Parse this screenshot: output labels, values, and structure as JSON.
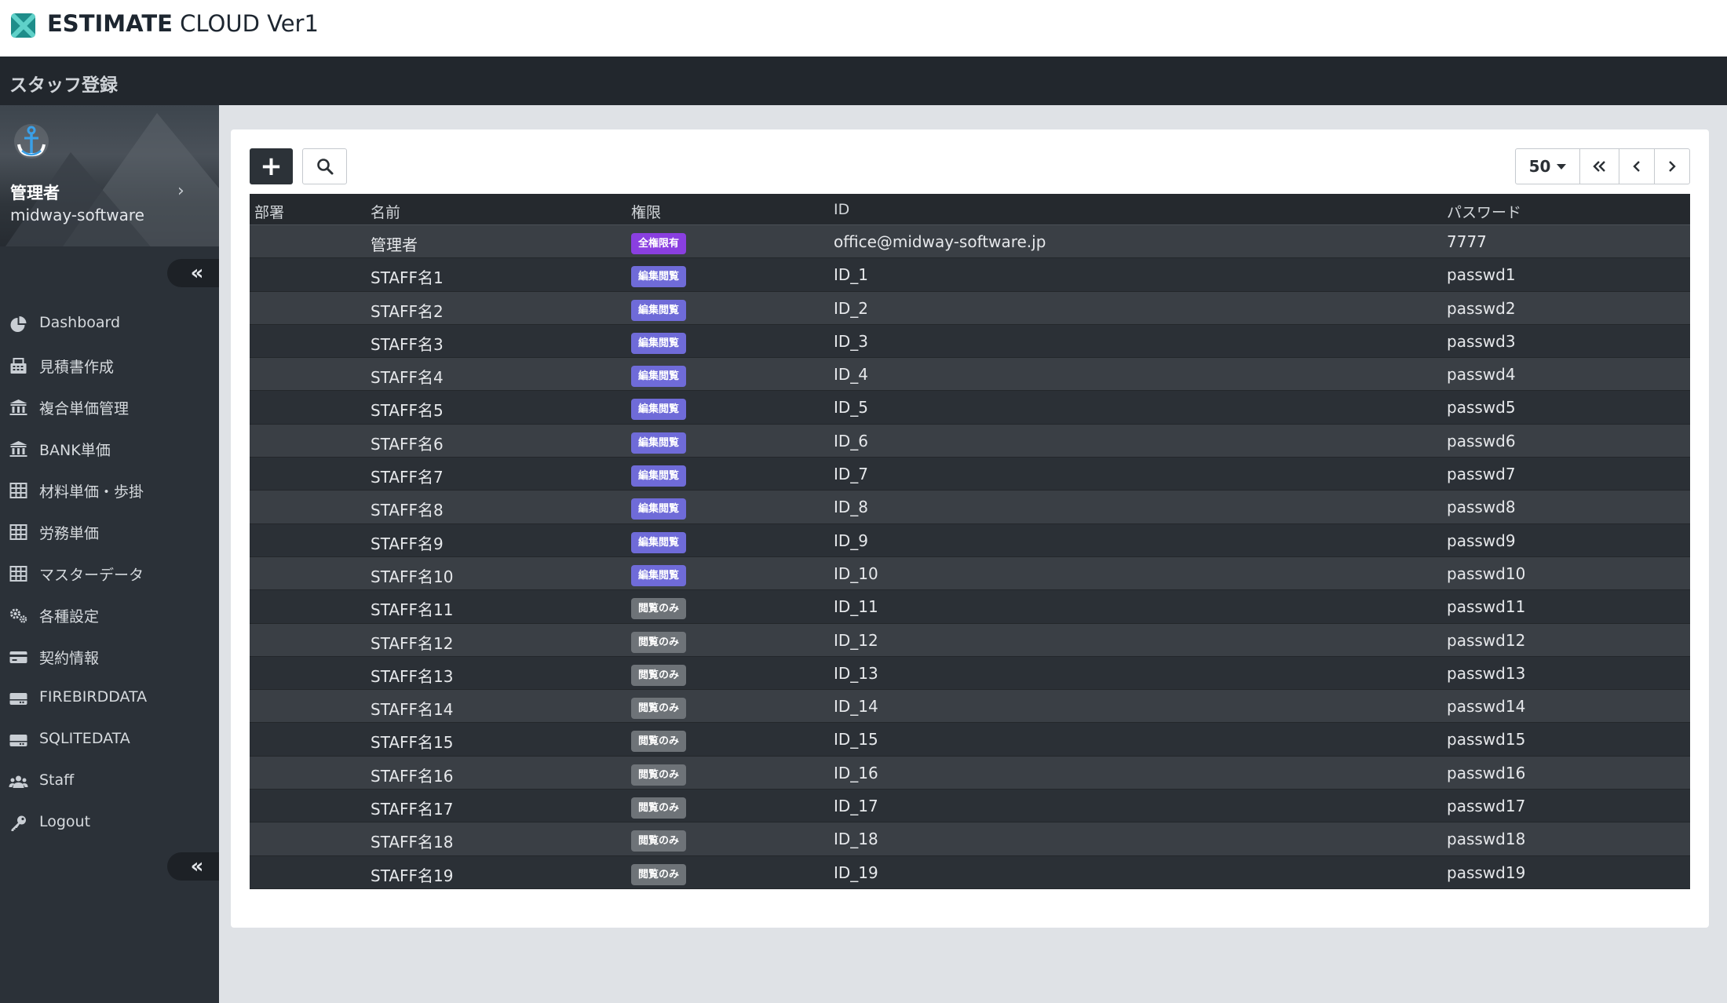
{
  "app": {
    "title_bold": "ESTIMATE",
    "title_rest": " CLOUD Ver1",
    "accent_color": "#1e8d8a"
  },
  "page": {
    "title": "スタッフ登録"
  },
  "sidebar": {
    "profile": {
      "name": "管理者",
      "org": "midway-software",
      "avatar_icon": "anchor-icon"
    },
    "collapse_label": "«",
    "items": [
      {
        "label": "Dashboard",
        "icon": "pie-chart-icon"
      },
      {
        "label": "見積書作成",
        "icon": "calculator-icon"
      },
      {
        "label": "複合単価管理",
        "icon": "bank-icon"
      },
      {
        "label": "BANK単価",
        "icon": "bank-icon"
      },
      {
        "label": "材料単価・歩掛",
        "icon": "table-icon"
      },
      {
        "label": "労務単価",
        "icon": "table-icon"
      },
      {
        "label": "マスターデータ",
        "icon": "table-icon"
      },
      {
        "label": "各種設定",
        "icon": "gears-icon"
      },
      {
        "label": "契約情報",
        "icon": "credit-card-icon"
      },
      {
        "label": "FIREBIRDDATA",
        "icon": "hdd-icon"
      },
      {
        "label": "SQLITEDATA",
        "icon": "hdd-icon"
      },
      {
        "label": "Staff",
        "icon": "users-icon"
      },
      {
        "label": "Logout",
        "icon": "key-icon"
      }
    ]
  },
  "toolbar": {
    "add_label": "+",
    "page_size": "50"
  },
  "table": {
    "headers": [
      "部署",
      "名前",
      "権限",
      "ID",
      "パスワード"
    ],
    "role_colors": {
      "全権限有": "#8a3fe0",
      "編集閲覧": "#6f6bd8",
      "閲覧のみ": "#6e7378"
    },
    "rows": [
      {
        "dept": "",
        "name": "管理者",
        "role": "全権限有",
        "id": "office@midway-software.jp",
        "password": "7777"
      },
      {
        "dept": "",
        "name": "STAFF名1",
        "role": "編集閲覧",
        "id": "ID_1",
        "password": "passwd1"
      },
      {
        "dept": "",
        "name": "STAFF名2",
        "role": "編集閲覧",
        "id": "ID_2",
        "password": "passwd2"
      },
      {
        "dept": "",
        "name": "STAFF名3",
        "role": "編集閲覧",
        "id": "ID_3",
        "password": "passwd3"
      },
      {
        "dept": "",
        "name": "STAFF名4",
        "role": "編集閲覧",
        "id": "ID_4",
        "password": "passwd4"
      },
      {
        "dept": "",
        "name": "STAFF名5",
        "role": "編集閲覧",
        "id": "ID_5",
        "password": "passwd5"
      },
      {
        "dept": "",
        "name": "STAFF名6",
        "role": "編集閲覧",
        "id": "ID_6",
        "password": "passwd6"
      },
      {
        "dept": "",
        "name": "STAFF名7",
        "role": "編集閲覧",
        "id": "ID_7",
        "password": "passwd7"
      },
      {
        "dept": "",
        "name": "STAFF名8",
        "role": "編集閲覧",
        "id": "ID_8",
        "password": "passwd8"
      },
      {
        "dept": "",
        "name": "STAFF名9",
        "role": "編集閲覧",
        "id": "ID_9",
        "password": "passwd9"
      },
      {
        "dept": "",
        "name": "STAFF名10",
        "role": "編集閲覧",
        "id": "ID_10",
        "password": "passwd10"
      },
      {
        "dept": "",
        "name": "STAFF名11",
        "role": "閲覧のみ",
        "id": "ID_11",
        "password": "passwd11"
      },
      {
        "dept": "",
        "name": "STAFF名12",
        "role": "閲覧のみ",
        "id": "ID_12",
        "password": "passwd12"
      },
      {
        "dept": "",
        "name": "STAFF名13",
        "role": "閲覧のみ",
        "id": "ID_13",
        "password": "passwd13"
      },
      {
        "dept": "",
        "name": "STAFF名14",
        "role": "閲覧のみ",
        "id": "ID_14",
        "password": "passwd14"
      },
      {
        "dept": "",
        "name": "STAFF名15",
        "role": "閲覧のみ",
        "id": "ID_15",
        "password": "passwd15"
      },
      {
        "dept": "",
        "name": "STAFF名16",
        "role": "閲覧のみ",
        "id": "ID_16",
        "password": "passwd16"
      },
      {
        "dept": "",
        "name": "STAFF名17",
        "role": "閲覧のみ",
        "id": "ID_17",
        "password": "passwd17"
      },
      {
        "dept": "",
        "name": "STAFF名18",
        "role": "閲覧のみ",
        "id": "ID_18",
        "password": "passwd18"
      },
      {
        "dept": "",
        "name": "STAFF名19",
        "role": "閲覧のみ",
        "id": "ID_19",
        "password": "passwd19"
      }
    ]
  }
}
